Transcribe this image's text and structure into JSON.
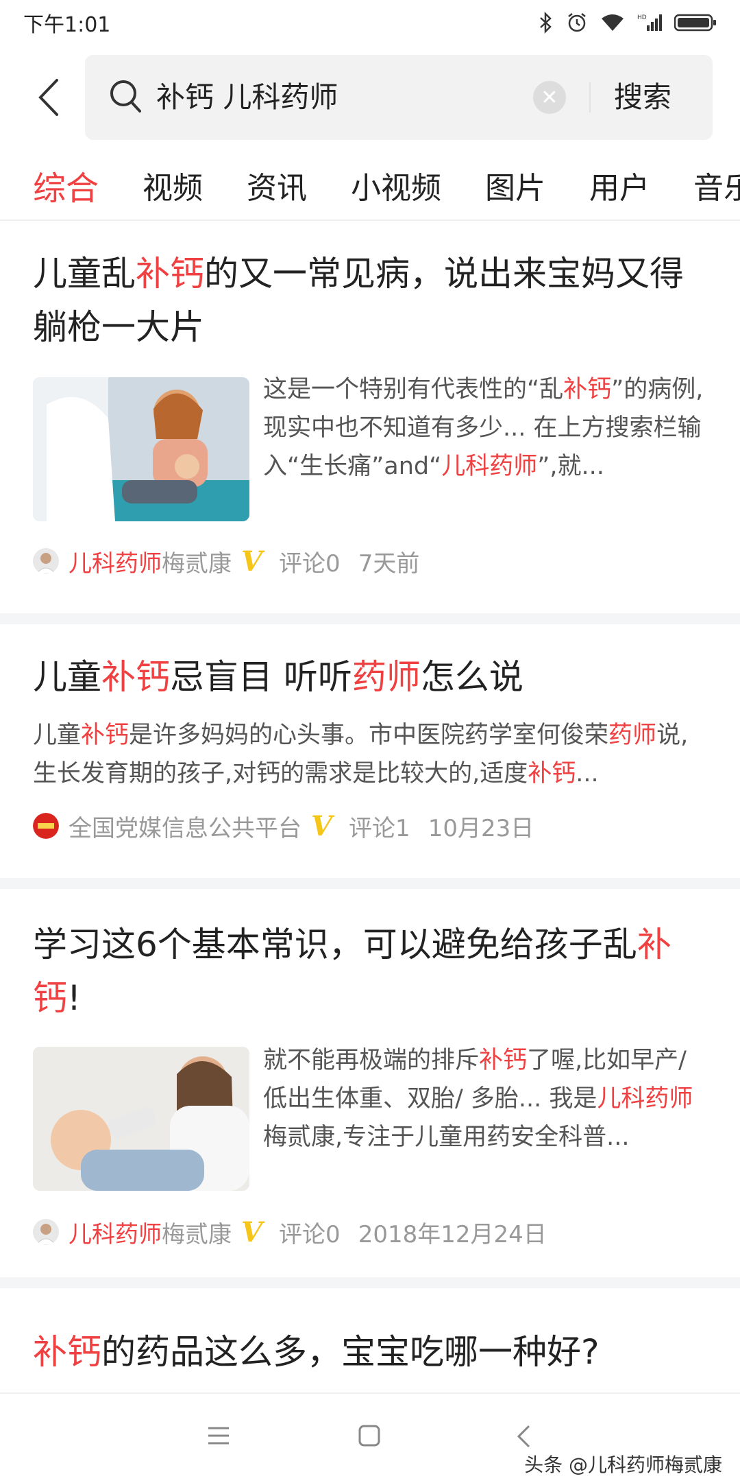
{
  "status_bar": {
    "time": "下午1:01"
  },
  "search": {
    "query": "补钙 儿科药师",
    "button": "搜索"
  },
  "tabs": [
    "综合",
    "视频",
    "资讯",
    "小视频",
    "图片",
    "用户",
    "音乐"
  ],
  "colors": {
    "accent": "#f04142",
    "verified": "#f5c518"
  },
  "articles": [
    {
      "title_parts": [
        "儿童乱",
        "补钙",
        "的又一常见病，说出来宝妈又得躺枪一大片"
      ],
      "summary_parts": [
        "这是一个特别有代表性的“乱",
        "补钙",
        "”的病例,现实中也不知道有多少... 在上方搜索栏输入“生长痛”and“",
        "儿科药师",
        "”,就..."
      ],
      "author_hl": "儿科药师",
      "author_rest": "梅贰康",
      "comments": "评论0",
      "time": "7天前"
    },
    {
      "title_parts": [
        "儿童",
        "补钙",
        "忌盲目 听听",
        "药师",
        "怎么说"
      ],
      "summary_parts": [
        "儿童",
        "补钙",
        "是许多妈妈的心头事。市中医院药学室何俊荣",
        "药师",
        "说,生长发育期的孩子,对钙的需求是比较大的,适度",
        "补钙",
        "..."
      ],
      "author_hl": "",
      "author_rest": "全国党媒信息公共平台",
      "comments": "评论1",
      "time": "10月23日"
    },
    {
      "title_parts": [
        "学习这6个基本常识，可以避免给孩子乱",
        "补钙",
        "!"
      ],
      "summary_parts": [
        "就不能再极端的排斥",
        "补钙",
        "了喔,比如早产/低出生体重、双胎/ 多胎... 我是",
        "儿科药师",
        "梅贰康,专注于儿童用药安全科普..."
      ],
      "author_hl": "儿科药师",
      "author_rest": "梅贰康",
      "comments": "评论0",
      "time": "2018年12月24日"
    },
    {
      "title_parts": [
        "补钙",
        "的药品这么多，宝宝吃哪一种好?"
      ]
    }
  ],
  "watermark": "头条 @儿科药师梅贰康"
}
